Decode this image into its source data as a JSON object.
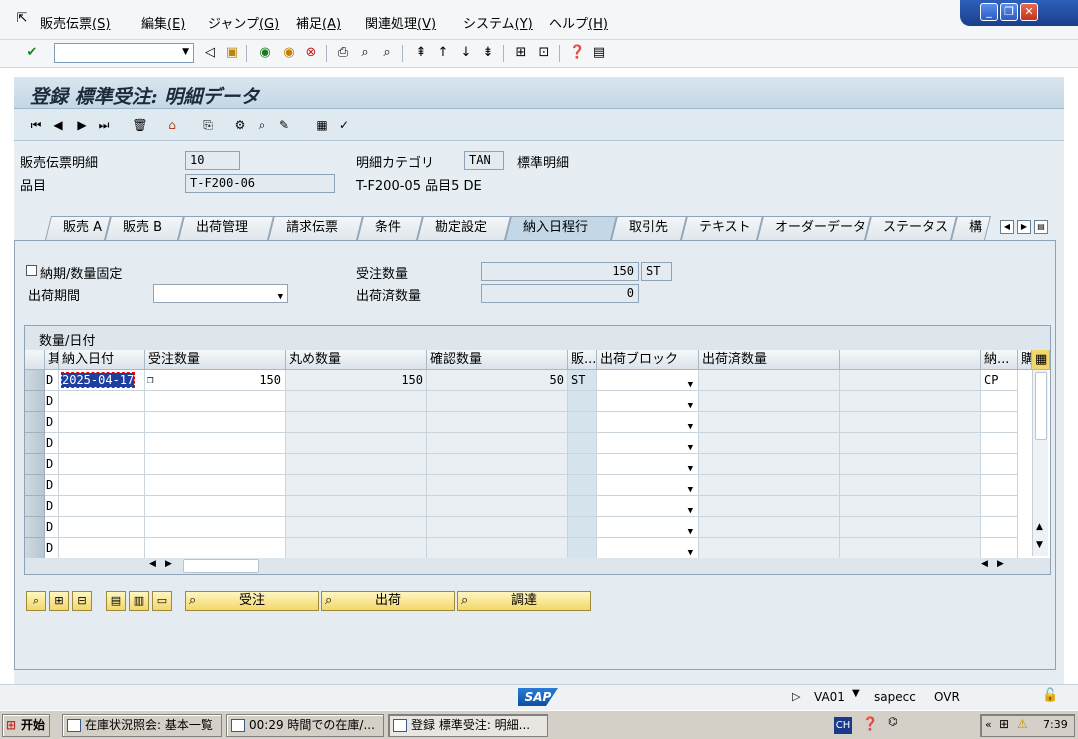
{
  "menu": {
    "items": [
      {
        "label": "販売伝票",
        "key": "(S)"
      },
      {
        "label": "編集",
        "key": "(E)"
      },
      {
        "label": "ジャンプ",
        "key": "(G)"
      },
      {
        "label": "補足",
        "key": "(A)"
      },
      {
        "label": "関連処理",
        "key": "(V)"
      },
      {
        "label": "システム",
        "key": "(Y)"
      },
      {
        "label": "ヘルプ",
        "key": "(H)"
      }
    ]
  },
  "title": "登録 標準受注: 明細データ",
  "header": {
    "item_label": "販売伝票明細",
    "item_value": "10",
    "category_label": "明細カテゴリ",
    "category_value": "TAN",
    "category_text": "標準明細",
    "material_label": "品目",
    "material_value": "T-F200-06",
    "material_desc": "T-F200-05  品目5 DE"
  },
  "tabs": [
    {
      "label": "販売 A"
    },
    {
      "label": "販売 B"
    },
    {
      "label": "出荷管理"
    },
    {
      "label": "請求伝票"
    },
    {
      "label": "条件"
    },
    {
      "label": "勘定設定"
    },
    {
      "label": "納入日程行"
    },
    {
      "label": "取引先"
    },
    {
      "label": "テキスト"
    },
    {
      "label": "オーダーデータ"
    },
    {
      "label": "ステータス"
    },
    {
      "label": "構"
    }
  ],
  "form": {
    "fixed_label": "納期/数量固定",
    "shipping_period_label": "出荷期間",
    "order_qty_label": "受注数量",
    "order_qty_value": "150",
    "order_qty_unit": "ST",
    "shipped_qty_label": "出荷済数量",
    "shipped_qty_value": "0"
  },
  "table": {
    "title": "数量/日付",
    "columns": [
      "其",
      "納入日付",
      "受注数量",
      "丸め数量",
      "確認数量",
      "販...",
      "出荷ブロック",
      "出荷済数量",
      "",
      "納...",
      "購"
    ],
    "first_row": {
      "type": "D",
      "date": "2025-04-17",
      "order_qty": "150",
      "rounded_qty": "150",
      "confirmed_qty": "50",
      "unit": "ST",
      "col_code": "CP"
    },
    "empty_type": "D"
  },
  "buttons": {
    "order": "受注",
    "shipping": "出荷",
    "procurement": "調達"
  },
  "status": {
    "tcode": "VA01",
    "system": "sapecc",
    "mode": "OVR"
  },
  "taskbar": {
    "start": "开始",
    "tasks": [
      "在庫状況照会: 基本一覧",
      "00:29 時間での在庫/...",
      "登録 標準受注: 明細..."
    ],
    "lang": "CH",
    "time": "7:39"
  }
}
